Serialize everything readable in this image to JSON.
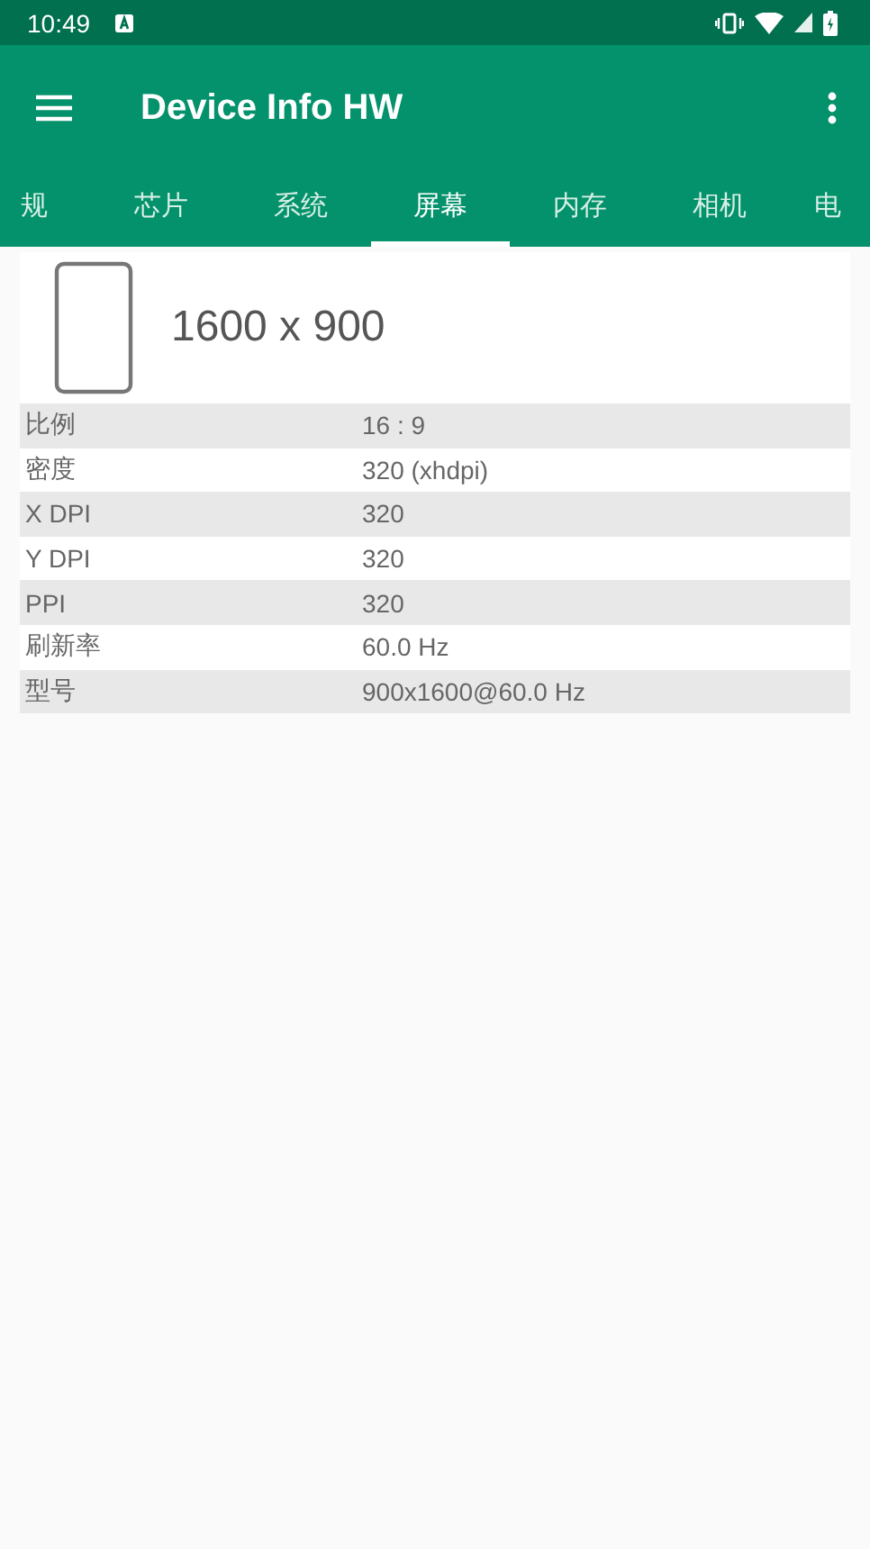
{
  "status_bar": {
    "time": "10:49"
  },
  "app_bar": {
    "title": "Device Info HW"
  },
  "tabs": [
    {
      "label": "规",
      "selected": false
    },
    {
      "label": "芯片",
      "selected": false
    },
    {
      "label": "系统",
      "selected": false
    },
    {
      "label": "屏幕",
      "selected": true
    },
    {
      "label": "内存",
      "selected": false
    },
    {
      "label": "相机",
      "selected": false
    },
    {
      "label": "电",
      "selected": false
    }
  ],
  "screen": {
    "resolution": "1600 x 900"
  },
  "rows": [
    {
      "label": "比例",
      "value": "16 : 9"
    },
    {
      "label": "密度",
      "value": "320 (xhdpi)"
    },
    {
      "label": "X DPI",
      "value": "320"
    },
    {
      "label": "Y DPI",
      "value": "320"
    },
    {
      "label": "PPI",
      "value": "320"
    },
    {
      "label": "刷新率",
      "value": "60.0 Hz"
    },
    {
      "label": "型号",
      "value": "900x1600@60.0 Hz"
    }
  ]
}
